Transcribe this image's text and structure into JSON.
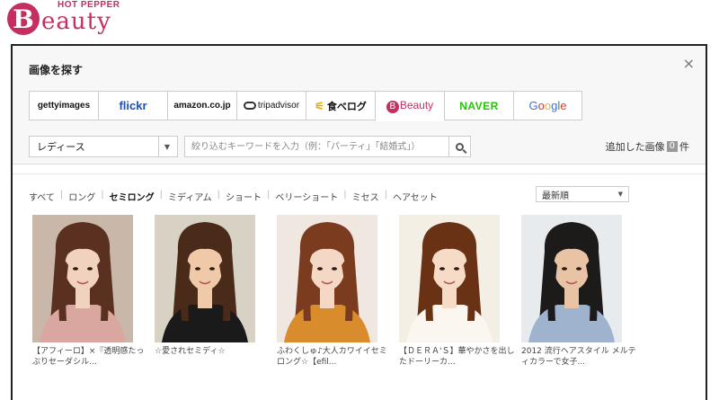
{
  "brand": {
    "hot_pepper": "HOT PEPPER",
    "letter": "B",
    "word": "eauty"
  },
  "modal": {
    "title": "画像を探す",
    "close": "×",
    "tabs": [
      {
        "name": "getty",
        "label": "gettyimages"
      },
      {
        "name": "flickr",
        "label": "flickr"
      },
      {
        "name": "amazon",
        "label": "amazon.co.jp"
      },
      {
        "name": "tripadvisor",
        "label": "tripadvisor"
      },
      {
        "name": "tabelog",
        "label": "食べログ"
      },
      {
        "name": "beauty",
        "label": "Beauty"
      },
      {
        "name": "naver",
        "label": "NAVER"
      },
      {
        "name": "google",
        "label": "Google"
      }
    ],
    "added": {
      "prefix": "追加した画像",
      "count": "0",
      "suffix": "件"
    },
    "search": {
      "category_value": "レディース",
      "placeholder": "絞り込むキーワードを入力（例：「パーティ」「結婚式」）"
    },
    "categories": [
      "すべて",
      "ロング",
      "セミロング",
      "ミディアム",
      "ショート",
      "ベリーショート",
      "ミセス",
      "ヘアセット"
    ],
    "active_category": "セミロング",
    "sort_value": "最新順",
    "results": [
      {
        "caption": "【アフィーロ】×『透明感たっぷりセーダシル...",
        "bg": "#c9b8a9",
        "hair": "#5a3020",
        "skin": "#f1d2bf",
        "cloth": "#d9a6a0"
      },
      {
        "caption": "☆愛されセミディ☆",
        "bg": "#d8d2c4",
        "hair": "#4a2a18",
        "skin": "#efc9a8",
        "cloth": "#1a1a1a"
      },
      {
        "caption": "ふわくしゅ♪大人カワイイセミロング☆【efil...",
        "bg": "#efe7e0",
        "hair": "#7a3b1e",
        "skin": "#f4d7c4",
        "cloth": "#d98c2b"
      },
      {
        "caption": "【ＤＥＲＡ'Ｓ】華やかさを出したドーリーカ...",
        "bg": "#f4efe4",
        "hair": "#6a3215",
        "skin": "#f6dcc6",
        "cloth": "#fbf6f0"
      },
      {
        "caption": "2012 流行ヘアスタイル メルティカラーで女子...",
        "bg": "#e8ebee",
        "hair": "#1d1a1a",
        "skin": "#e8c3a4",
        "cloth": "#9fb3cf"
      }
    ]
  }
}
